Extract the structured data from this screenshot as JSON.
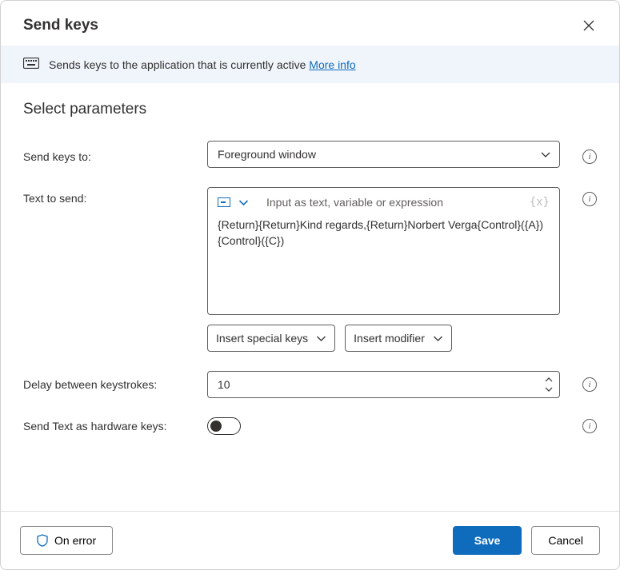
{
  "header": {
    "title": "Send keys"
  },
  "banner": {
    "text": "Sends keys to the application that is currently active ",
    "link": "More info"
  },
  "section_title": "Select parameters",
  "fields": {
    "send_to": {
      "label": "Send keys to:",
      "value": "Foreground window"
    },
    "text_to_send": {
      "label": "Text to send:",
      "placeholder": "Input as text, variable or expression",
      "value": "{Return}{Return}Kind regards,{Return}Norbert Verga{Control}({A}){Control}({C})",
      "insert_special": "Insert special keys",
      "insert_modifier": "Insert modifier"
    },
    "delay": {
      "label": "Delay between keystrokes:",
      "value": "10"
    },
    "hardware": {
      "label": "Send Text as hardware keys:",
      "on": false
    }
  },
  "footer": {
    "on_error": "On error",
    "save": "Save",
    "cancel": "Cancel"
  }
}
